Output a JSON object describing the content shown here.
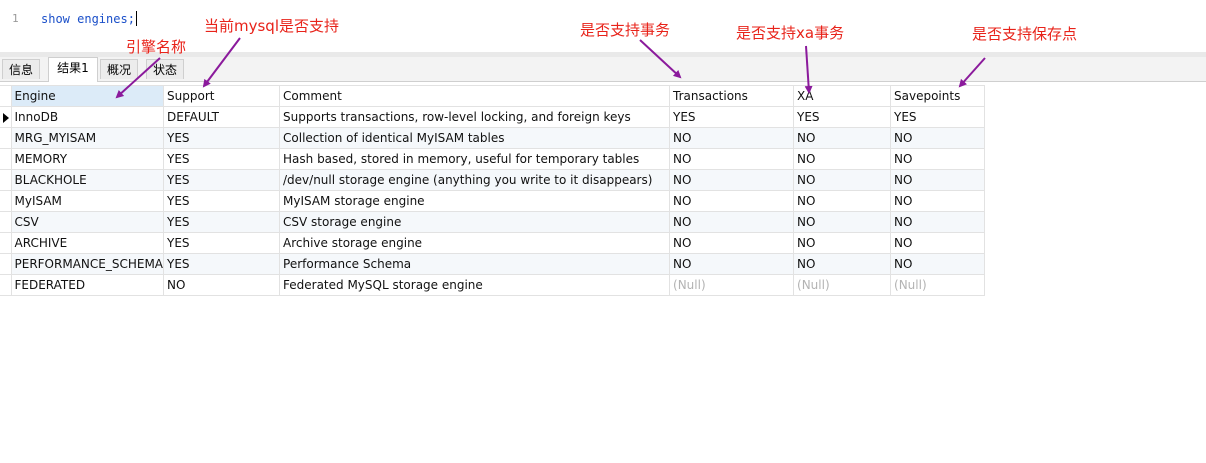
{
  "editor": {
    "line_number": "1",
    "code": "show engines;"
  },
  "tabs": [
    {
      "label": "信息"
    },
    {
      "label": "结果1"
    },
    {
      "label": "概况"
    },
    {
      "label": "状态"
    }
  ],
  "table": {
    "columns": [
      "Engine",
      "Support",
      "Comment",
      "Transactions",
      "XA",
      "Savepoints"
    ],
    "rows": [
      [
        "InnoDB",
        "DEFAULT",
        "Supports transactions, row-level locking, and foreign keys",
        "YES",
        "YES",
        "YES"
      ],
      [
        "MRG_MYISAM",
        "YES",
        "Collection of identical MyISAM tables",
        "NO",
        "NO",
        "NO"
      ],
      [
        "MEMORY",
        "YES",
        "Hash based, stored in memory, useful for temporary tables",
        "NO",
        "NO",
        "NO"
      ],
      [
        "BLACKHOLE",
        "YES",
        "/dev/null storage engine (anything you write to it disappears)",
        "NO",
        "NO",
        "NO"
      ],
      [
        "MyISAM",
        "YES",
        "MyISAM storage engine",
        "NO",
        "NO",
        "NO"
      ],
      [
        "CSV",
        "YES",
        "CSV storage engine",
        "NO",
        "NO",
        "NO"
      ],
      [
        "ARCHIVE",
        "YES",
        "Archive storage engine",
        "NO",
        "NO",
        "NO"
      ],
      [
        "PERFORMANCE_SCHEMA",
        "YES",
        "Performance Schema",
        "NO",
        "NO",
        "NO"
      ],
      [
        "FEDERATED",
        "NO",
        "Federated MySQL storage engine",
        "(Null)",
        "(Null)",
        "(Null)"
      ]
    ]
  },
  "annotations": {
    "engine_name": "引擎名称",
    "support": "当前mysql是否支持",
    "transactions": "是否支持事务",
    "xa": "是否支持xa事务",
    "savepoints": "是否支持保存点"
  },
  "colors": {
    "annotation_text": "#e8231a",
    "arrow": "#8b1a9c",
    "selected_header": "#dcebf8"
  }
}
